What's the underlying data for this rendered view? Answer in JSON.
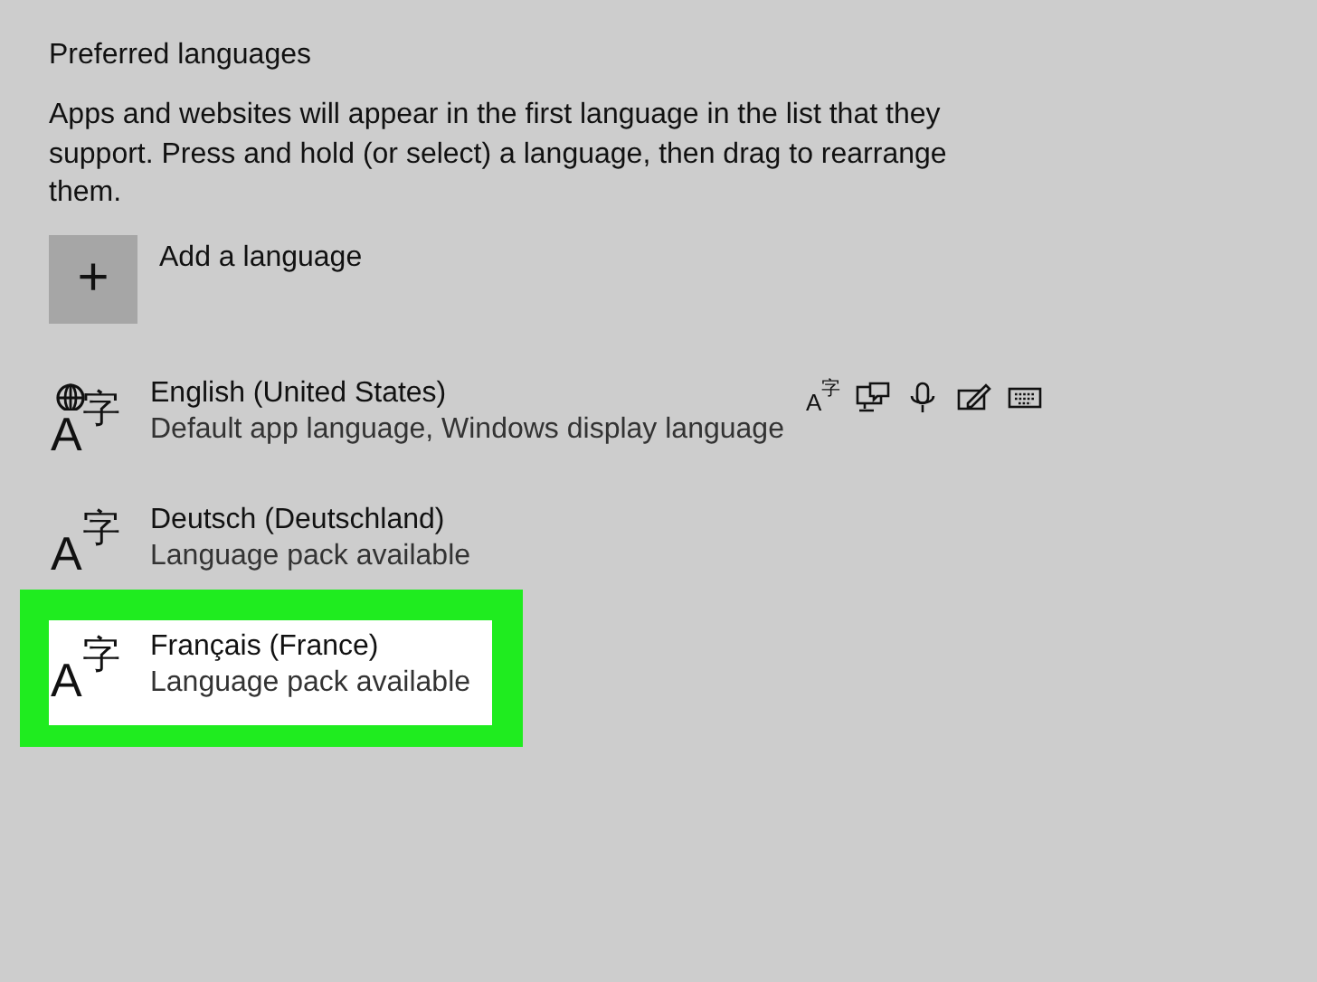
{
  "section_title": "Preferred languages",
  "description": "Apps and websites will appear in the first language in the list that they support. Press and hold (or select) a language, then drag to rearrange them.",
  "add_button": {
    "icon": "+",
    "label": "Add a language"
  },
  "languages": [
    {
      "name": "English (United States)",
      "detail": "Default app language, Windows display language",
      "glyph_large": "A",
      "glyph_small": "字",
      "display_language": true,
      "selected": false,
      "features": [
        {
          "kind": "font",
          "glyph_large": "A",
          "glyph_small": "字"
        },
        {
          "kind": "text-to-speech"
        },
        {
          "kind": "speech"
        },
        {
          "kind": "handwriting"
        },
        {
          "kind": "keyboard"
        }
      ]
    },
    {
      "name": "Deutsch (Deutschland)",
      "detail": "Language pack available",
      "glyph_large": "A",
      "glyph_small": "字",
      "display_language": false,
      "selected": false
    },
    {
      "name": "Français (France)",
      "detail": "Language pack available",
      "glyph_large": "A",
      "glyph_small": "字",
      "display_language": false,
      "selected": true
    }
  ]
}
